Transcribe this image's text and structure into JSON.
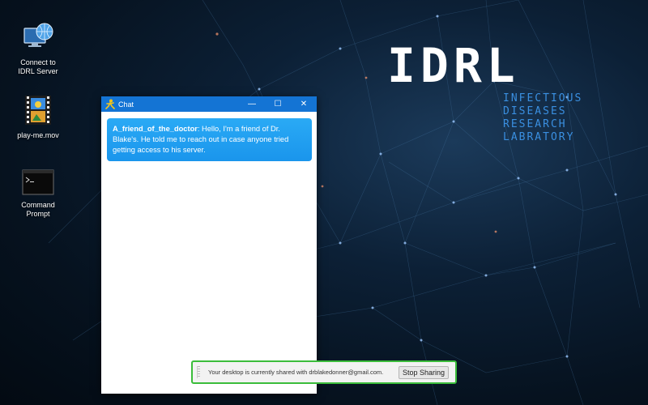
{
  "desktop": {
    "icons": [
      {
        "label": "Connect to IDRL Server",
        "icon": "network-globe-icon"
      },
      {
        "label": "play-me.mov",
        "icon": "video-file-icon"
      },
      {
        "label": "Command Prompt",
        "icon": "terminal-icon"
      }
    ]
  },
  "brand": {
    "title": "IDRL",
    "subtitle_lines": [
      "INFECTIOUS",
      "DISEASES",
      "RESEARCH",
      "LABRATORY"
    ]
  },
  "chat": {
    "title": "Chat",
    "app_icon": "running-man-icon",
    "message": {
      "sender": "A_friend_of_the_doctor",
      "text": "Hello, I'm a friend of Dr. Blake's. He told me to reach out in case anyone tried getting access to his server."
    }
  },
  "share_bar": {
    "text": "Your desktop is currently shared with drblakedonner@gmail.com.",
    "button": "Stop Sharing"
  },
  "colors": {
    "titlebar": "#1474d4",
    "message_bubble": "#1a95ec",
    "share_border": "#3bbd3b",
    "brand_accent": "#3a8fe0"
  }
}
